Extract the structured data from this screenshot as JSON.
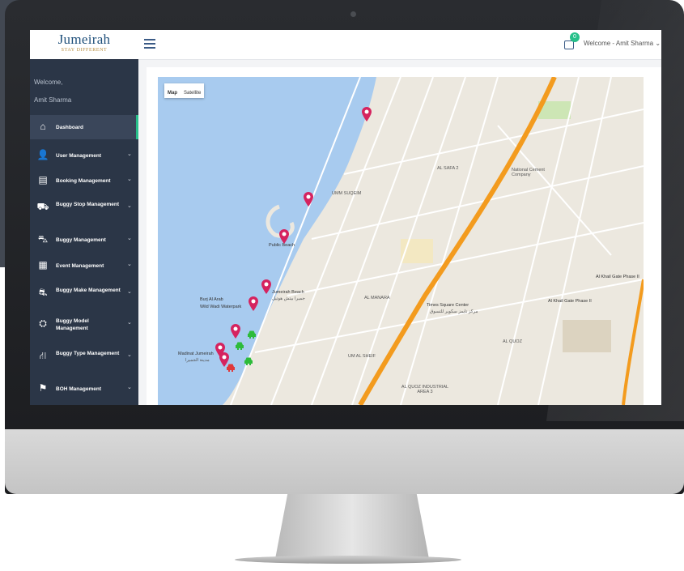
{
  "header": {
    "logo_name": "Jumeirah",
    "logo_tagline": "STAY DIFFERENT",
    "notification_count": "0",
    "welcome_user": "Welcome - Amit Sharma"
  },
  "sidebar": {
    "welcome": "Welcome,",
    "user_name": "Amit Sharma",
    "items": [
      {
        "label": "Dashboard",
        "icon": "home-icon",
        "active": true
      },
      {
        "label": "User Management",
        "icon": "user-icon"
      },
      {
        "label": "Booking Management",
        "icon": "booking-icon"
      },
      {
        "label": "Buggy Stop Management",
        "icon": "buggy-stop-icon"
      },
      {
        "label": "Buggy Management",
        "icon": "buggy-icon"
      },
      {
        "label": "Event Management",
        "icon": "calendar-icon"
      },
      {
        "label": "Buggy Make Management",
        "icon": "car-icon"
      },
      {
        "label": "Buggy Model Management",
        "icon": "model-icon"
      },
      {
        "label": "Buggy Type Management",
        "icon": "type-icon"
      },
      {
        "label": "BOH Management",
        "icon": "boh-icon"
      }
    ]
  },
  "map": {
    "tabs": [
      "Map",
      "Satellite"
    ],
    "labels": {
      "umm_suqeim": "UMM SUQEIM",
      "al_safa": "AL SAFA 2",
      "national_cement": "National Cement Company",
      "public_beach": "Public Beach",
      "jumeirah_beach": "Jumeirah Beach",
      "jumeirah_beach_ar": "جميرا بيتش هوتيل",
      "burj_al_arab": "Burj Al Arab",
      "wild_wadi": "Wild Wadi Waterpark",
      "al_manara": "AL MANARA",
      "times_square": "Times Square Center",
      "times_square_ar": "مركز تايمز سكوير للتسوق",
      "al_khail_gate": "Al Khail Gate Phase II",
      "al_khail_gate_2": "Al Khail Gate Phase II",
      "madinat": "Madinat Jumeirah",
      "madinat_ar": "مدينة الجميرا",
      "umm_al_sheif": "UM AL SHEIF",
      "al_quoz": "AL QUOZ",
      "al_quoz_industrial": "AL QUOZ INDUSTRIAL AREA 3"
    }
  },
  "colors": {
    "sidebar_bg": "#2b3647",
    "accent": "#27c08a",
    "pin": "#d5235f",
    "car_green": "#2dbb3a",
    "car_red": "#e0383a",
    "highway": "#f39b1e",
    "water": "#a8cbef"
  }
}
